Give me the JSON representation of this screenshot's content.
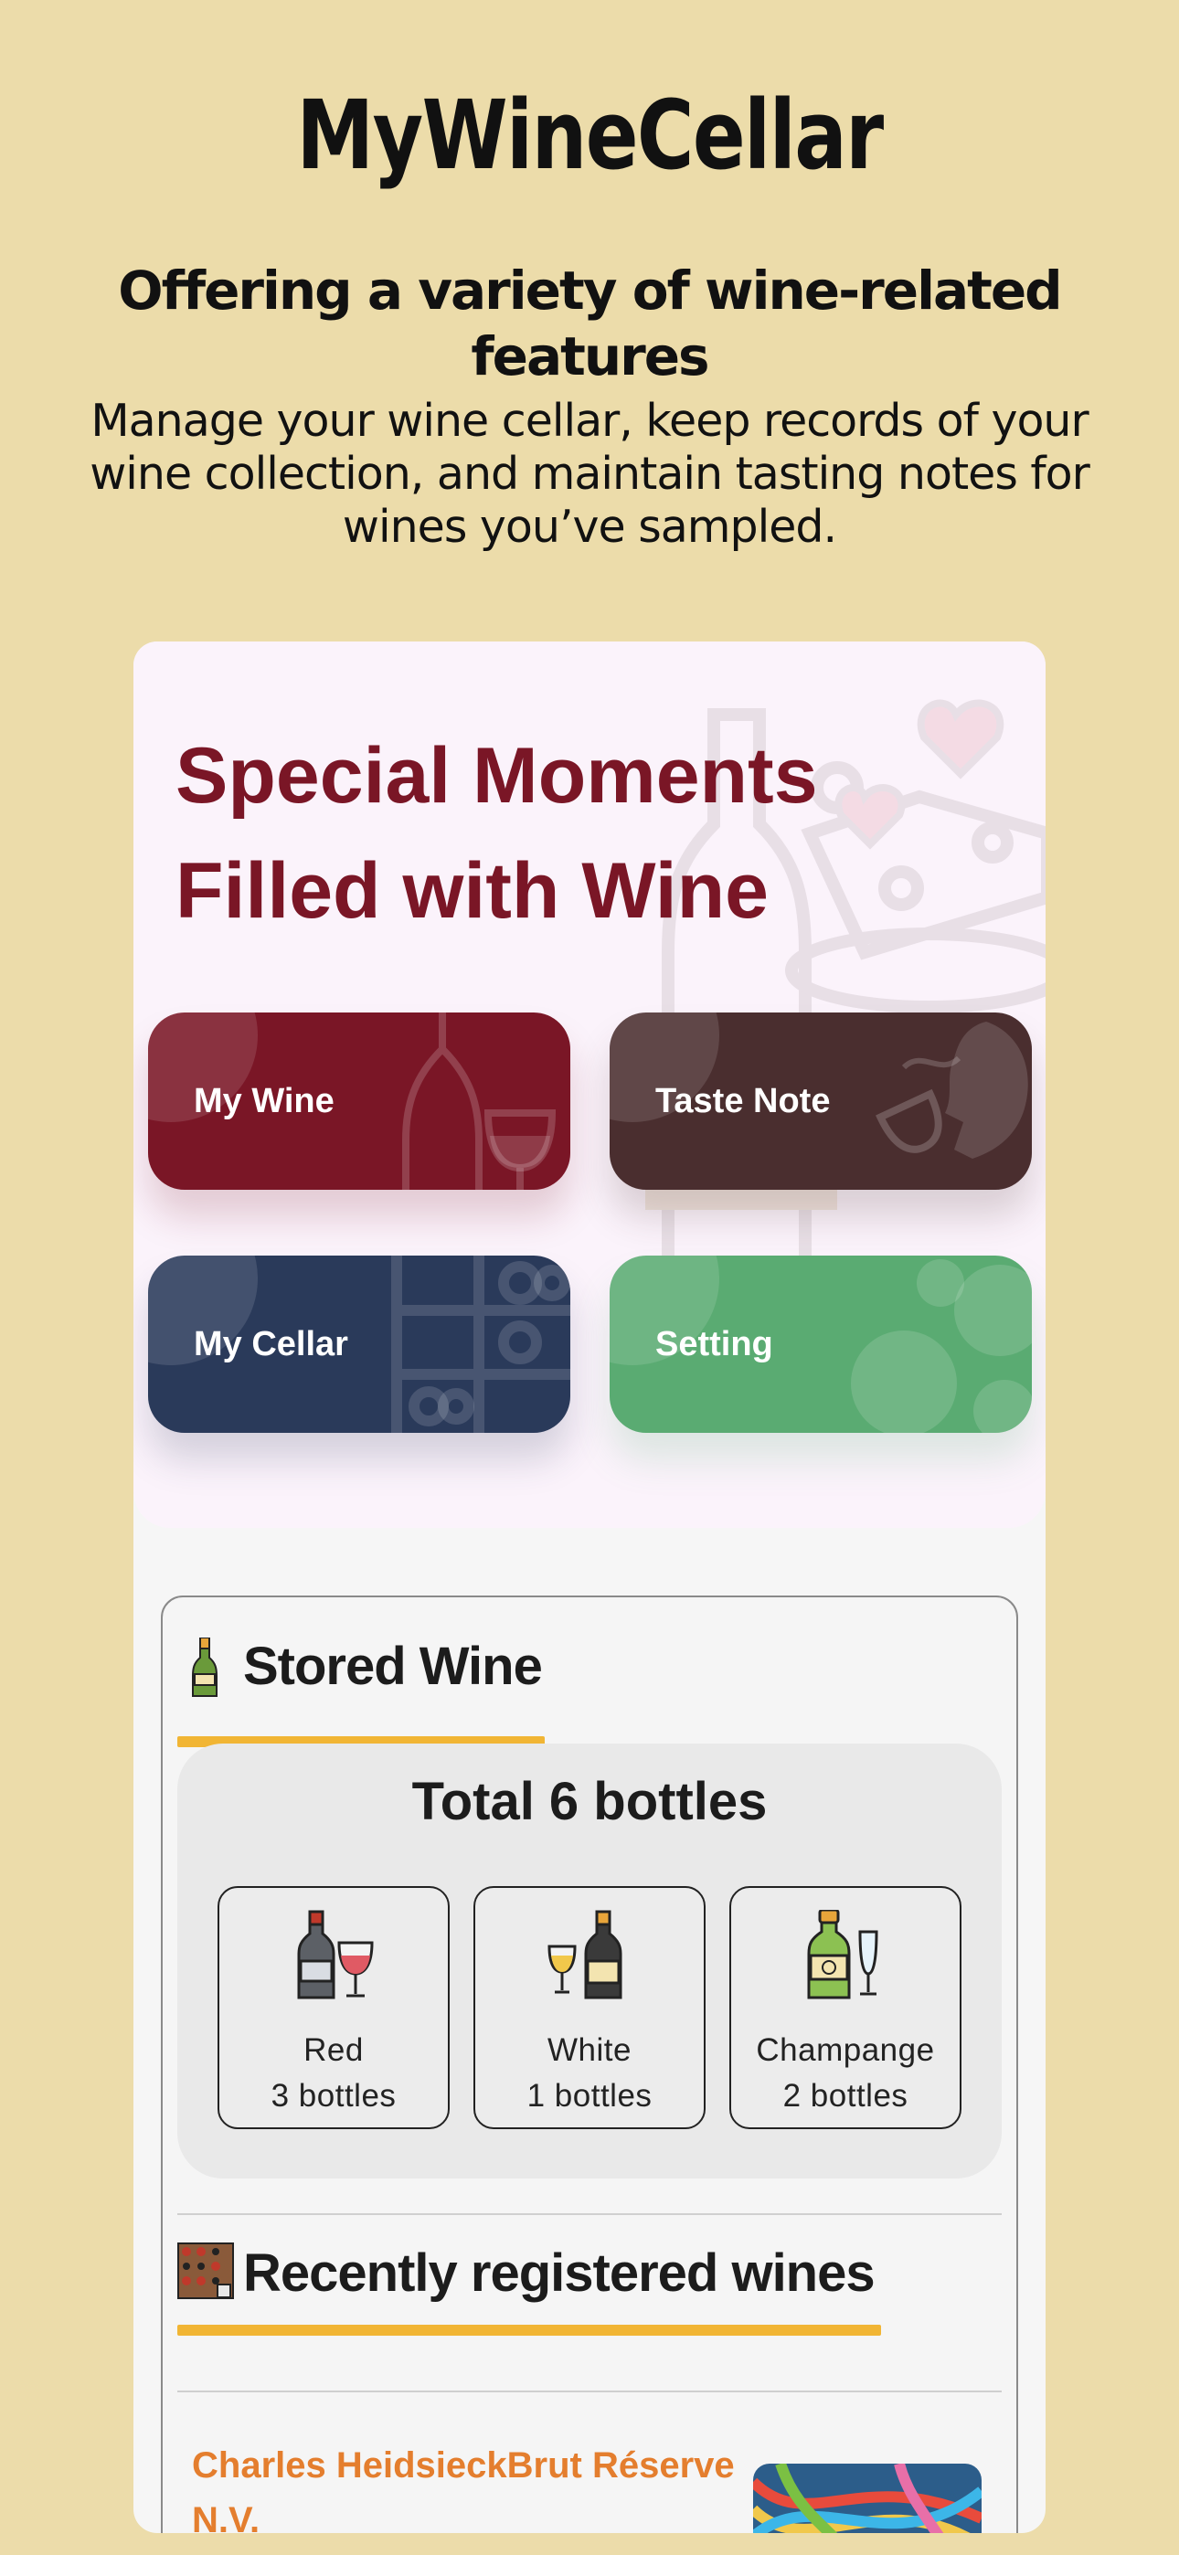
{
  "app": {
    "title": "MyWineCellar",
    "subtitle": "Offering a variety of wine-related features",
    "description": "Manage your wine cellar, keep records of your wine collection, and maintain tasting notes for wines you’ve sampled."
  },
  "hero": {
    "heading_line1": "Special Moments",
    "heading_line2": "Filled with Wine",
    "heading_color": "#7a1626"
  },
  "menu": {
    "my_wine": "My Wine",
    "taste_note": "Taste Note",
    "my_cellar": "My Cellar",
    "setting": "Setting"
  },
  "colors": {
    "background": "#ecdcaa",
    "my_wine": "#7a1626",
    "taste_note": "#4a2e2f",
    "my_cellar": "#2a3a5a",
    "setting": "#5aab72",
    "accent_underline": "#f1b534",
    "wine_name": "#e47e2e"
  },
  "stored": {
    "icon": "champagne-bottle-icon",
    "title": "Stored Wine",
    "total": "Total 6 bottles",
    "types": [
      {
        "icon": "red-wine-icon",
        "name": "Red",
        "count": "3 bottles"
      },
      {
        "icon": "white-wine-icon",
        "name": "White",
        "count": "1 bottles"
      },
      {
        "icon": "champagne-icon",
        "name": "Champange",
        "count": "2 bottles"
      }
    ]
  },
  "recent": {
    "icon": "wine-rack-icon",
    "title": "Recently registered wines",
    "items": [
      {
        "name": "Charles HeidsieckBrut Réserve N.V."
      }
    ]
  }
}
